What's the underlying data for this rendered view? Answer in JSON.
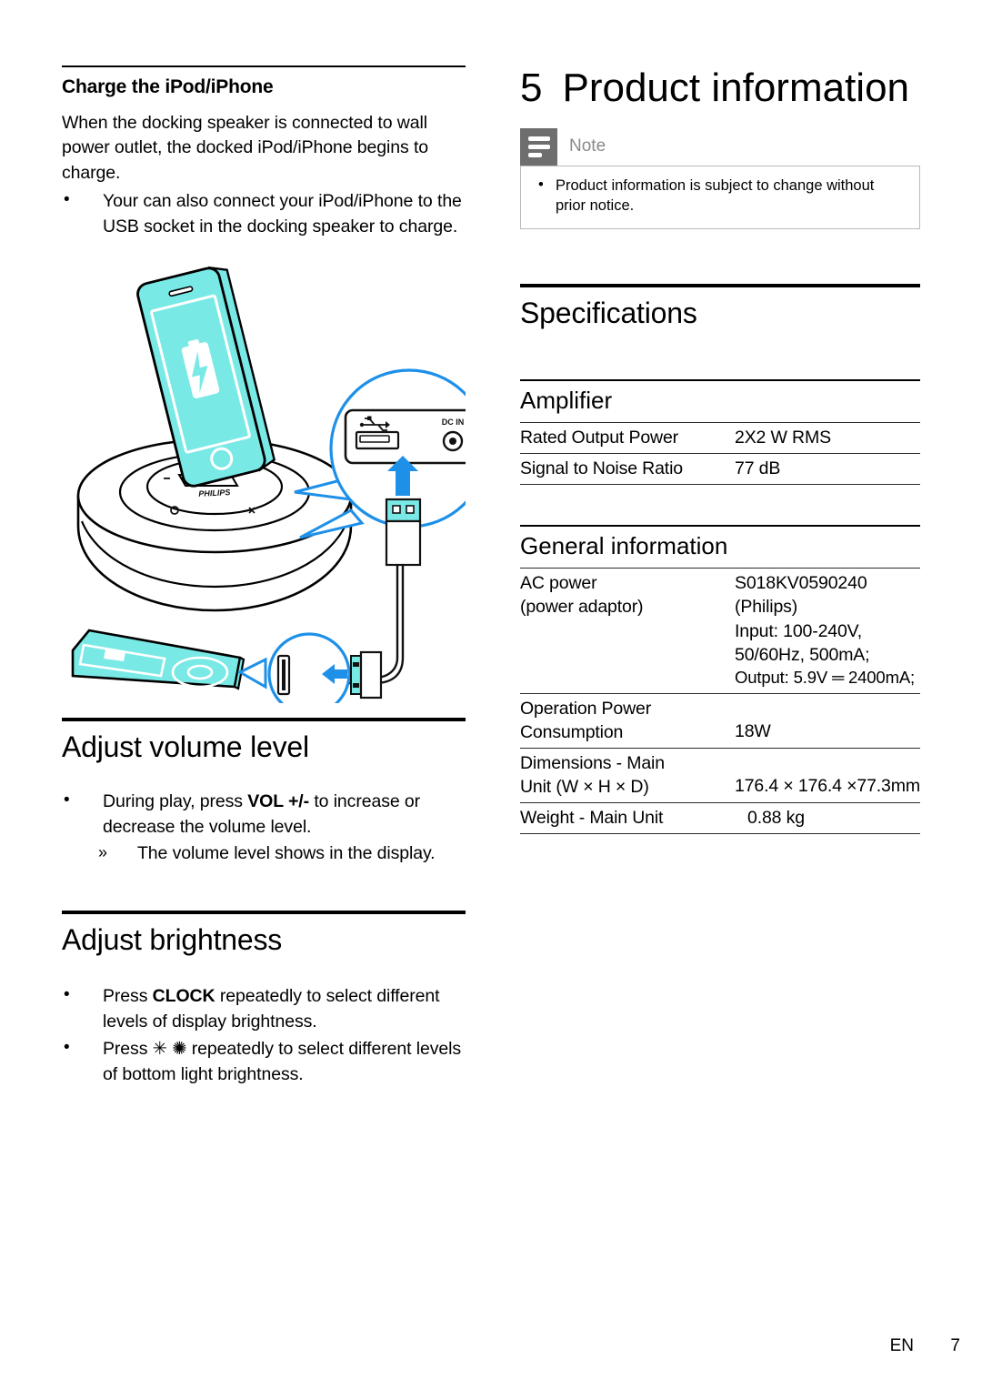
{
  "page": {
    "footer_language": "EN",
    "footer_page_number": "7"
  },
  "left_column": {
    "section_charge": {
      "heading": "Charge the iPod/iPhone",
      "paragraph": "When the docking speaker is connected to wall power outlet, the docked iPod/iPhone begins to charge.",
      "bullets": [
        "Your can also connect your iPod/iPhone to the USB socket in the docking speaker to charge."
      ]
    },
    "illustration": {
      "caption_labels": {
        "dc_in": "DC IN",
        "brand": "PHILIPS"
      },
      "colors": {
        "device_fill": "#79e9e6",
        "callout_blue": "#1e90e8",
        "outline": "#000000"
      },
      "described_icons": [
        "battery-charging-icon",
        "usb-symbol-icon",
        "dc-in-jack-icon",
        "home-button-icon",
        "ipod-click-wheel-icon"
      ]
    },
    "section_volume": {
      "heading": "Adjust volume level",
      "bullets": [
        {
          "pre": "During play, press ",
          "bold": "VOL +/-",
          "post": " to increase or decrease the volume level."
        }
      ],
      "sub_bullets": [
        "The volume level shows in the display."
      ]
    },
    "section_brightness": {
      "heading": "Adjust brightness",
      "bullets": [
        {
          "pre": "Press ",
          "bold": "CLOCK",
          "post": " repeatedly to select different levels of display brightness."
        },
        {
          "pre": "Press ",
          "bold": "✳ ✺",
          "post": " repeatedly to select different levels of bottom light brightness."
        }
      ]
    }
  },
  "right_column": {
    "chapter": {
      "number": "5",
      "title": "Product information"
    },
    "note": {
      "label": "Note",
      "bullets": [
        "Product information is subject to change without prior notice."
      ]
    },
    "specifications": {
      "heading": "Specifications",
      "amplifier": {
        "heading": "Amplifier",
        "rows": [
          {
            "key": "Rated Output Power",
            "value": "2X2 W RMS"
          },
          {
            "key": "Signal to Noise Ratio",
            "value": "77 dB"
          }
        ]
      },
      "general_information": {
        "heading": "General information",
        "rows": [
          {
            "key": "AC power (power adaptor)",
            "value": "S018KV0590240 (Philips) Input: 100-240V, 50/60Hz, 500mA; Output: 5.9V ═ 2400mA;"
          },
          {
            "key": "Operation Power Consumption",
            "value": "18W"
          },
          {
            "key": "Dimensions - Main Unit (W x H x D)",
            "value": "176.4 x 176.4 x77.3mm"
          },
          {
            "key": "Weight - Main Unit",
            "value": "0.88 kg"
          }
        ],
        "row_details": {
          "ac_power_key_lines": [
            "AC power",
            "(power adaptor)"
          ],
          "ac_power_value_lines": [
            "S018KV0590240",
            "(Philips)",
            "Input: 100-240V,",
            "50/60Hz, 500mA;",
            "Output: 5.9V ═ 2400mA;"
          ],
          "operation_key_lines": [
            "Operation Power",
            "Consumption"
          ],
          "operation_value": "18W",
          "dimensions_key_lines": [
            "Dimensions - Main",
            "Unit (W × H × D)"
          ],
          "dimensions_value": "176.4 × 176.4 ×77.3mm",
          "weight_key": "Weight - Main Unit",
          "weight_value": "0.88 kg"
        }
      }
    }
  }
}
